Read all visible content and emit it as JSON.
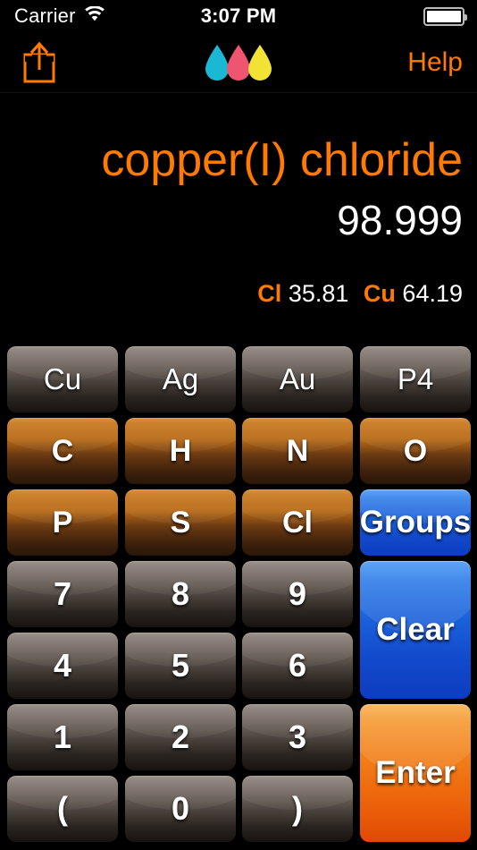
{
  "status_bar": {
    "carrier": "Carrier",
    "wifi_icon": "wifi-icon",
    "time": "3:07 PM",
    "battery_icon": "battery-full-icon"
  },
  "nav_bar": {
    "share_icon": "share-icon",
    "logo_icon": "three-droplets-logo",
    "help_label": "Help"
  },
  "display": {
    "compound_name": "copper(I) chloride",
    "molar_mass": "98.999",
    "composition": [
      {
        "symbol": "Cl",
        "percent": "35.81"
      },
      {
        "symbol": "Cu",
        "percent": "64.19"
      }
    ]
  },
  "keypad": {
    "keys": [
      {
        "label": "Cu",
        "name": "key-cu",
        "style": "gray"
      },
      {
        "label": "Ag",
        "name": "key-ag",
        "style": "gray"
      },
      {
        "label": "Au",
        "name": "key-au",
        "style": "gray"
      },
      {
        "label": "P4",
        "name": "key-p4",
        "style": "gray"
      },
      {
        "label": "C",
        "name": "key-c",
        "style": "orange"
      },
      {
        "label": "H",
        "name": "key-h",
        "style": "orange"
      },
      {
        "label": "N",
        "name": "key-n",
        "style": "orange"
      },
      {
        "label": "O",
        "name": "key-o",
        "style": "orange"
      },
      {
        "label": "P",
        "name": "key-p",
        "style": "orange"
      },
      {
        "label": "S",
        "name": "key-s",
        "style": "orange"
      },
      {
        "label": "Cl",
        "name": "key-cl",
        "style": "orange"
      },
      {
        "label": "Groups",
        "name": "key-groups",
        "style": "blue"
      },
      {
        "label": "7",
        "name": "key-7",
        "style": "digit"
      },
      {
        "label": "8",
        "name": "key-8",
        "style": "digit"
      },
      {
        "label": "9",
        "name": "key-9",
        "style": "digit"
      },
      {
        "label": "Clear",
        "name": "key-clear",
        "style": "blue"
      },
      {
        "label": "4",
        "name": "key-4",
        "style": "digit"
      },
      {
        "label": "5",
        "name": "key-5",
        "style": "digit"
      },
      {
        "label": "6",
        "name": "key-6",
        "style": "digit"
      },
      {
        "label": "1",
        "name": "key-1",
        "style": "digit"
      },
      {
        "label": "2",
        "name": "key-2",
        "style": "digit"
      },
      {
        "label": "3",
        "name": "key-3",
        "style": "digit"
      },
      {
        "label": "Enter",
        "name": "key-enter",
        "style": "enter"
      },
      {
        "label": "(",
        "name": "key-open-paren",
        "style": "digit"
      },
      {
        "label": "0",
        "name": "key-0",
        "style": "digit"
      },
      {
        "label": ")",
        "name": "key-close-paren",
        "style": "digit"
      }
    ]
  },
  "colors": {
    "accent_orange": "#FF7A00",
    "background": "#000000",
    "blue": "#1A5FDA",
    "enter_orange": "#EE6A0D",
    "droplet_cyan": "#1BB8D4",
    "droplet_pink": "#EF5470",
    "droplet_yellow": "#F2E235"
  }
}
